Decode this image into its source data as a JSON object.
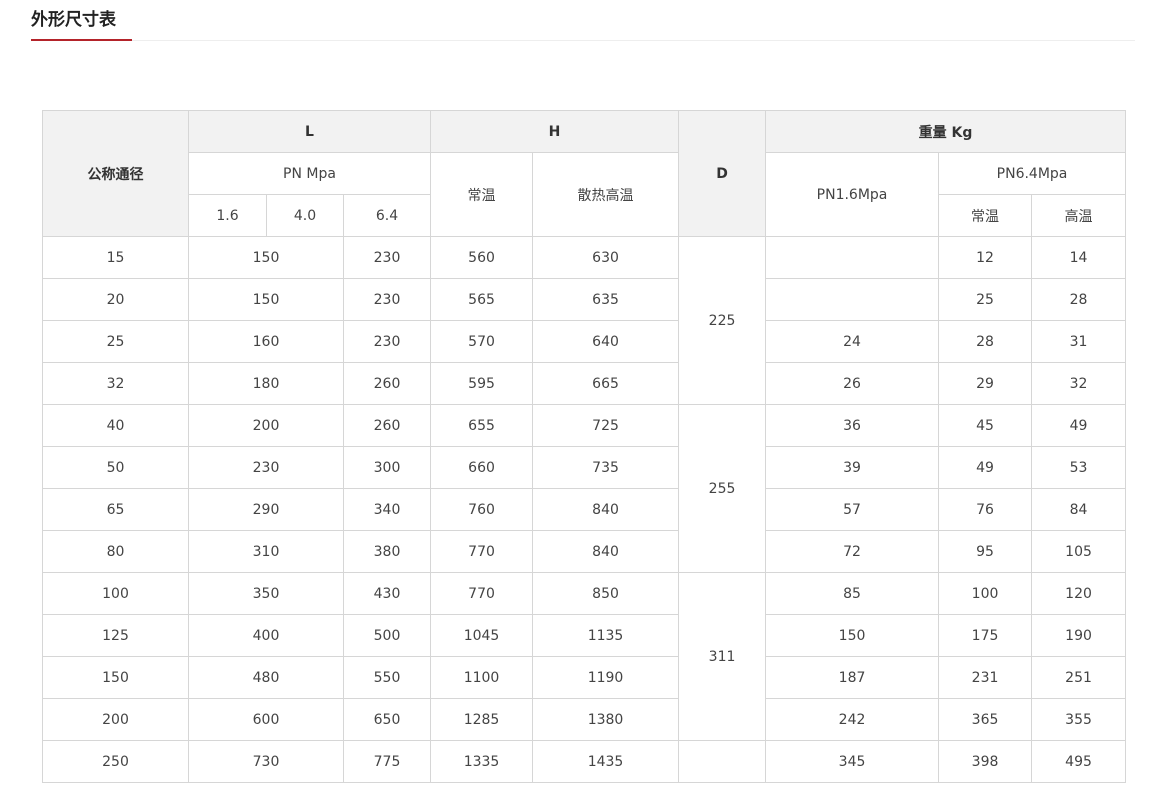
{
  "section_title": "外形尺寸表",
  "headers": {
    "nominal": "公称通径",
    "L": "L",
    "H": "H",
    "D": "D",
    "weight": "重量 Kg",
    "pn_mpa": "PN Mpa",
    "p16": "1.6",
    "p40": "4.0",
    "p64": "6.4",
    "h_normal": "常温",
    "h_high": "散热高温",
    "w_pn16": "PN1.6Mpa",
    "w_pn64": "PN6.4Mpa",
    "w_normal": "常温",
    "w_high": "高温"
  },
  "rows": [
    {
      "dn": "15",
      "l_16_40": "150",
      "l_64": "230",
      "h_normal": "560",
      "h_high": "630",
      "w16": "",
      "w64_normal": "12",
      "w64_high": "14"
    },
    {
      "dn": "20",
      "l_16_40": "150",
      "l_64": "230",
      "h_normal": "565",
      "h_high": "635",
      "w16": "",
      "w64_normal": "25",
      "w64_high": "28"
    },
    {
      "dn": "25",
      "l_16_40": "160",
      "l_64": "230",
      "h_normal": "570",
      "h_high": "640",
      "w16": "24",
      "w64_normal": "28",
      "w64_high": "31"
    },
    {
      "dn": "32",
      "l_16_40": "180",
      "l_64": "260",
      "h_normal": "595",
      "h_high": "665",
      "w16": "26",
      "w64_normal": "29",
      "w64_high": "32"
    },
    {
      "dn": "40",
      "l_16_40": "200",
      "l_64": "260",
      "h_normal": "655",
      "h_high": "725",
      "w16": "36",
      "w64_normal": "45",
      "w64_high": "49"
    },
    {
      "dn": "50",
      "l_16_40": "230",
      "l_64": "300",
      "h_normal": "660",
      "h_high": "735",
      "w16": "39",
      "w64_normal": "49",
      "w64_high": "53"
    },
    {
      "dn": "65",
      "l_16_40": "290",
      "l_64": "340",
      "h_normal": "760",
      "h_high": "840",
      "w16": "57",
      "w64_normal": "76",
      "w64_high": "84"
    },
    {
      "dn": "80",
      "l_16_40": "310",
      "l_64": "380",
      "h_normal": "770",
      "h_high": "840",
      "w16": "72",
      "w64_normal": "95",
      "w64_high": "105"
    },
    {
      "dn": "100",
      "l_16_40": "350",
      "l_64": "430",
      "h_normal": "770",
      "h_high": "850",
      "w16": "85",
      "w64_normal": "100",
      "w64_high": "120"
    },
    {
      "dn": "125",
      "l_16_40": "400",
      "l_64": "500",
      "h_normal": "1045",
      "h_high": "1135",
      "w16": "150",
      "w64_normal": "175",
      "w64_high": "190"
    },
    {
      "dn": "150",
      "l_16_40": "480",
      "l_64": "550",
      "h_normal": "1100",
      "h_high": "1190",
      "w16": "187",
      "w64_normal": "231",
      "w64_high": "251"
    },
    {
      "dn": "200",
      "l_16_40": "600",
      "l_64": "650",
      "h_normal": "1285",
      "h_high": "1380",
      "w16": "242",
      "w64_normal": "365",
      "w64_high": "355"
    },
    {
      "dn": "250",
      "l_16_40": "730",
      "l_64": "775",
      "h_normal": "1335",
      "h_high": "1435",
      "w16": "345",
      "w64_normal": "398",
      "w64_high": "495"
    }
  ],
  "d_groups": [
    {
      "value": "225",
      "span": 4
    },
    {
      "value": "255",
      "span": 4
    },
    {
      "value": "311",
      "span": 4
    },
    {
      "value": "",
      "span": 1
    }
  ]
}
